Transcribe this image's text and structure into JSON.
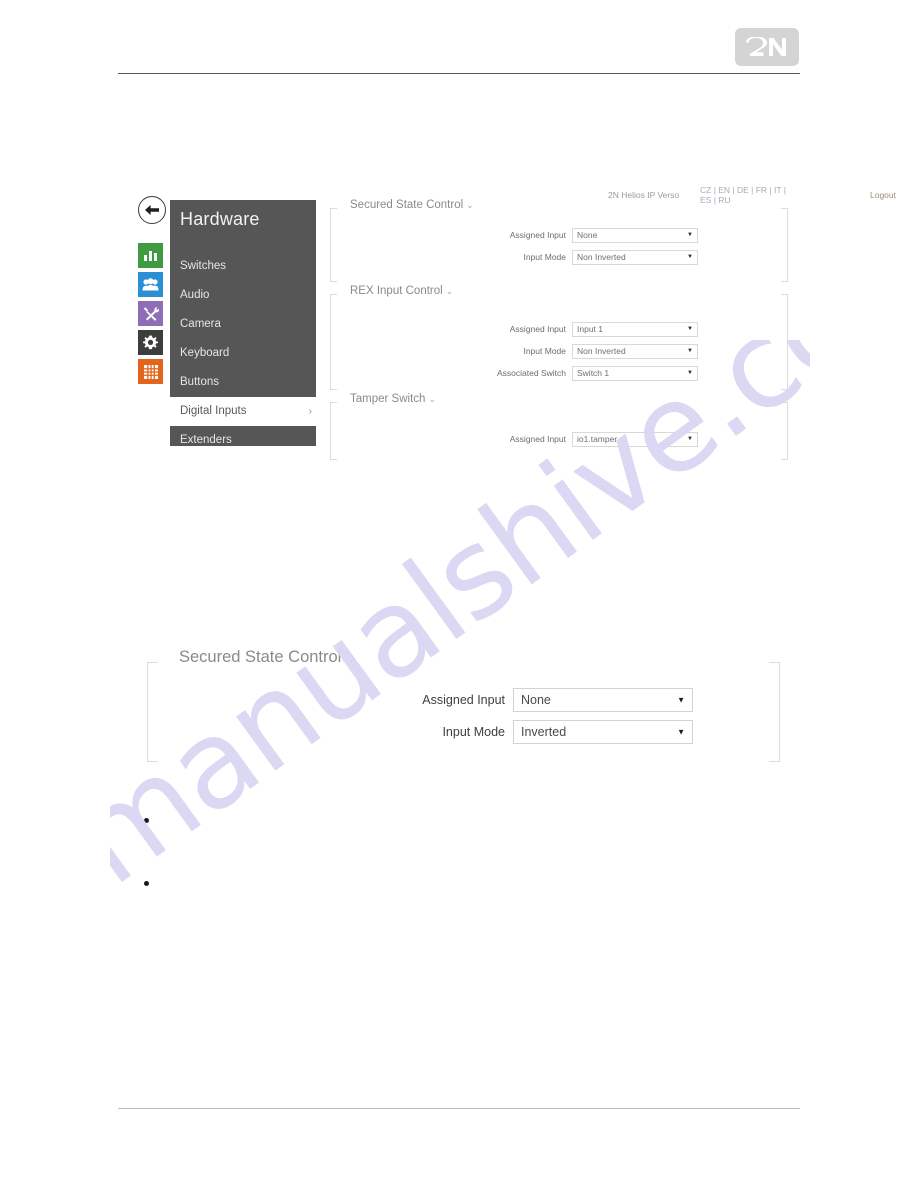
{
  "page": {
    "brand_logo_text": "2N",
    "brand_logo_color": "#d4d4d4",
    "watermark_text": "manualshive.com",
    "watermark_color": "#d9d6f2"
  },
  "screenshot_upper": {
    "topbar": {
      "device_name": "2N Helios IP Verso",
      "languages": "CZ | EN | DE | FR | IT | ES | RU",
      "logout_label": "Logout"
    },
    "rail": {
      "back_icon": "back-arrow-icon",
      "items": [
        {
          "icon": "bar-chart-icon",
          "color": "#3f9b3f"
        },
        {
          "icon": "users-icon",
          "color": "#2a8fd4"
        },
        {
          "icon": "tools-icon",
          "color": "#8e6fb5"
        },
        {
          "icon": "gear-icon",
          "color": "#3d3d3d"
        },
        {
          "icon": "grid-icon",
          "color": "#e2651b"
        }
      ]
    },
    "menu": {
      "title": "Hardware",
      "items": [
        {
          "label": "Switches",
          "active": false
        },
        {
          "label": "Audio",
          "active": false
        },
        {
          "label": "Camera",
          "active": false
        },
        {
          "label": "Keyboard",
          "active": false
        },
        {
          "label": "Buttons",
          "active": false
        },
        {
          "label": "Digital Inputs",
          "active": true
        },
        {
          "label": "Extenders",
          "active": false
        }
      ],
      "active_chevron": "›"
    },
    "sections": [
      {
        "legend": "Secured State Control",
        "caret": "⌄",
        "rows": [
          {
            "label": "Assigned Input",
            "value": "None"
          },
          {
            "label": "Input Mode",
            "value": "Non Inverted"
          }
        ]
      },
      {
        "legend": "REX Input Control",
        "caret": "⌄",
        "rows": [
          {
            "label": "Assigned Input",
            "value": "Input 1"
          },
          {
            "label": "Input Mode",
            "value": "Non Inverted"
          },
          {
            "label": "Associated Switch",
            "value": "Switch 1"
          }
        ]
      },
      {
        "legend": "Tamper Switch",
        "caret": "⌄",
        "rows": [
          {
            "label": "Assigned Input",
            "value": "io1.tamper"
          }
        ]
      }
    ]
  },
  "screenshot_lower": {
    "legend": "Secured State Control",
    "caret": "⌄",
    "rows": [
      {
        "label": "Assigned Input",
        "value": "None"
      },
      {
        "label": "Input Mode",
        "value": "Inverted"
      }
    ]
  },
  "bullets": [
    {
      "text": ""
    },
    {
      "text": ""
    }
  ]
}
